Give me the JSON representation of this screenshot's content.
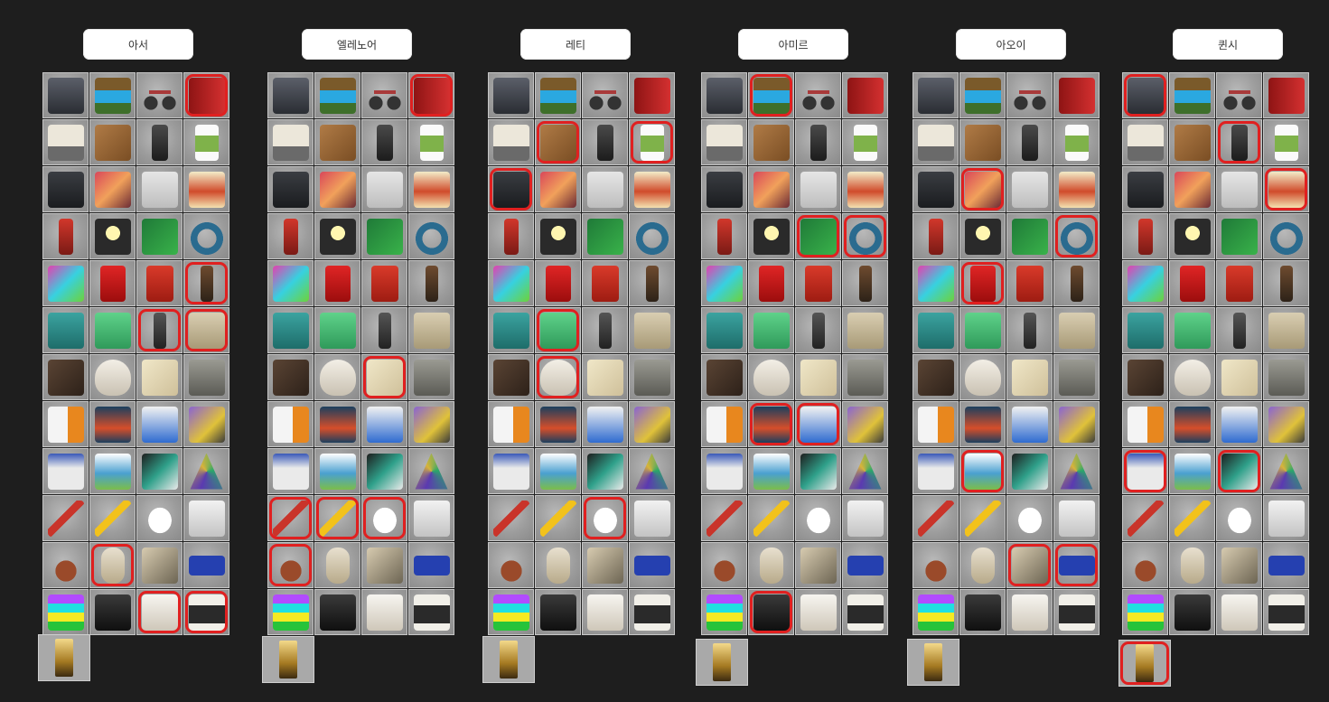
{
  "players": [
    {
      "name": "아서",
      "selected": [
        3,
        19,
        22,
        23,
        41,
        46,
        47
      ],
      "extra_selected": false
    },
    {
      "name": "엘레노어",
      "selected": [
        3,
        26,
        36,
        37,
        38,
        40
      ],
      "extra_selected": false
    },
    {
      "name": "레티",
      "selected": [
        5,
        7,
        8,
        21,
        25,
        38
      ],
      "extra_selected": false
    },
    {
      "name": "아미르",
      "selected": [
        1,
        14,
        15,
        29,
        30,
        45
      ],
      "extra_selected": false
    },
    {
      "name": "아오이",
      "selected": [
        9,
        15,
        17,
        33,
        42,
        43
      ],
      "extra_selected": false
    },
    {
      "name": "퀸시",
      "selected": [
        0,
        6,
        11,
        32,
        34
      ],
      "extra_selected": true
    }
  ],
  "icons": [
    "radio-icon",
    "pool-table-icon",
    "bicycle-icon",
    "door-icon",
    "calculator-icon",
    "cardboard-box-icon",
    "cell-phone-icon",
    "coffee-cup-icon",
    "coffee-maker-icon",
    "poster-icon",
    "desk-phone-icon",
    "religious-poster-icon",
    "fire-extinguisher-icon",
    "spotlight-icon",
    "circuit-board-icon",
    "headphones-icon",
    "crayons-icon",
    "gas-can-icon",
    "fuel-can-icon",
    "keys-icon",
    "toolbox-icon",
    "first-aid-kit-icon",
    "joystick-icon",
    "microwave-icon",
    "tray-icon",
    "mug-icon",
    "cutting-board-icon",
    "fax-phone-icon",
    "film-box-icon",
    "game-box-icon",
    "tv-box-icon",
    "drone-box-icon",
    "board-game-icon",
    "landscape-box-icon",
    "book-icon",
    "party-hat-icon",
    "pen-icon",
    "pencil-icon",
    "pillow-icon",
    "notebook-icon",
    "hanging-basket-icon",
    "propane-tank-icon",
    "scooter-icon",
    "arrow-sign-icon",
    "paper-stack-icon",
    "crt-tv-icon",
    "toaster-icon",
    "toaster-oven-icon"
  ],
  "extra_icon": "gold-bar-icon"
}
